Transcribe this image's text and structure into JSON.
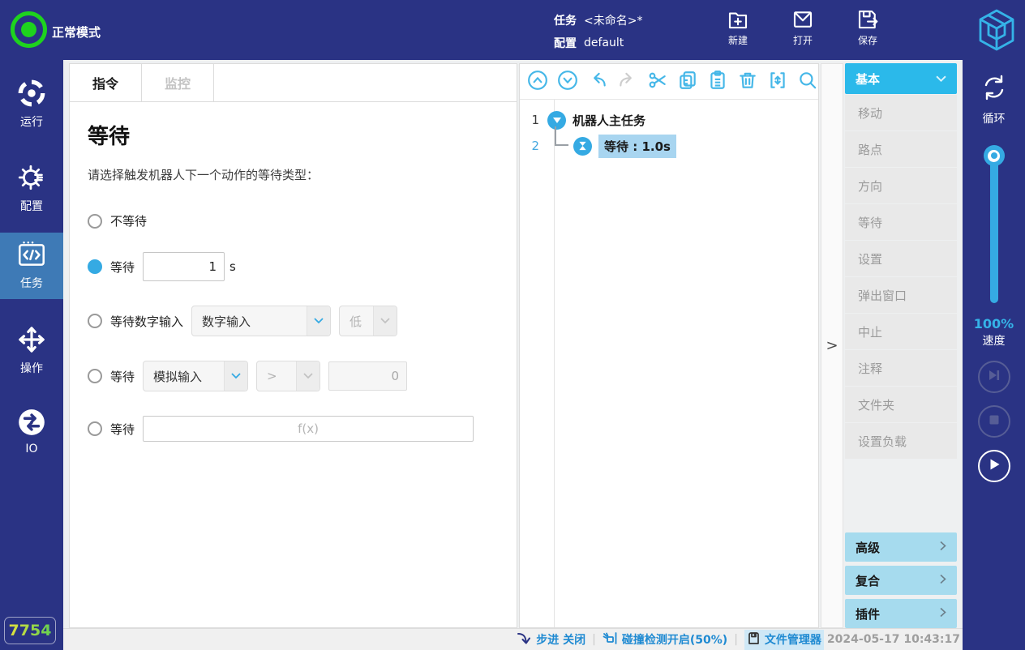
{
  "topbar": {
    "mode": "正常模式",
    "task_label": "任务",
    "task_value": "<未命名>*",
    "config_label": "配置",
    "config_value": "default",
    "new_label": "新建",
    "open_label": "打开",
    "save_label": "保存"
  },
  "sidebar": {
    "items": [
      {
        "label": "运行"
      },
      {
        "label": "配置"
      },
      {
        "label": "任务"
      },
      {
        "label": "操作"
      },
      {
        "label": "IO"
      }
    ],
    "badge": "7754"
  },
  "editor": {
    "tabs": [
      {
        "label": "指令"
      },
      {
        "label": "监控"
      }
    ],
    "title": "等待",
    "description": "请选择触发机器人下一个动作的等待类型：",
    "options": {
      "no_wait": "不等待",
      "wait": "等待",
      "wait_seconds_value": "1",
      "wait_seconds_unit": "s",
      "wait_digital": "等待数字输入",
      "digital_select": "数字输入",
      "digital_level": "低",
      "wait_analog": "等待",
      "analog_select": "模拟输入",
      "analog_op": ">",
      "analog_value": "0",
      "wait_expr": "等待",
      "expr_placeholder": "f(x)"
    }
  },
  "tree": {
    "rows": [
      {
        "num": "1",
        "label": "机器人主任务"
      },
      {
        "num": "2",
        "label": "等待 : 1.0s"
      }
    ]
  },
  "commands": {
    "header": "基本",
    "items": [
      "移动",
      "路点",
      "方向",
      "等待",
      "设置",
      "弹出窗口",
      "中止",
      "注释",
      "文件夹",
      "设置负载"
    ],
    "sections": [
      "高级",
      "复合",
      "插件"
    ]
  },
  "rightbar": {
    "loop_label": "循环",
    "speed_value": "100%",
    "speed_label": "速度"
  },
  "statusbar": {
    "step": "步进 关闭",
    "collision": "碰撞检测开启(50%)",
    "file_manager": "文件管理器",
    "timestamp": "2024-05-17 10:43:17"
  },
  "expander_glyph": ">",
  "colors": {
    "accent": "#35aae3",
    "topbar_bg": "#2a3384",
    "basic_header_bg": "#2bb9ea",
    "section_bg": "#a6dbee",
    "tree_highlight_bg": "#a8d5f0",
    "status_text": "#1f8ad2",
    "mode_green": "#1ed31e",
    "active_nav_bg": "#3e7ab6"
  }
}
